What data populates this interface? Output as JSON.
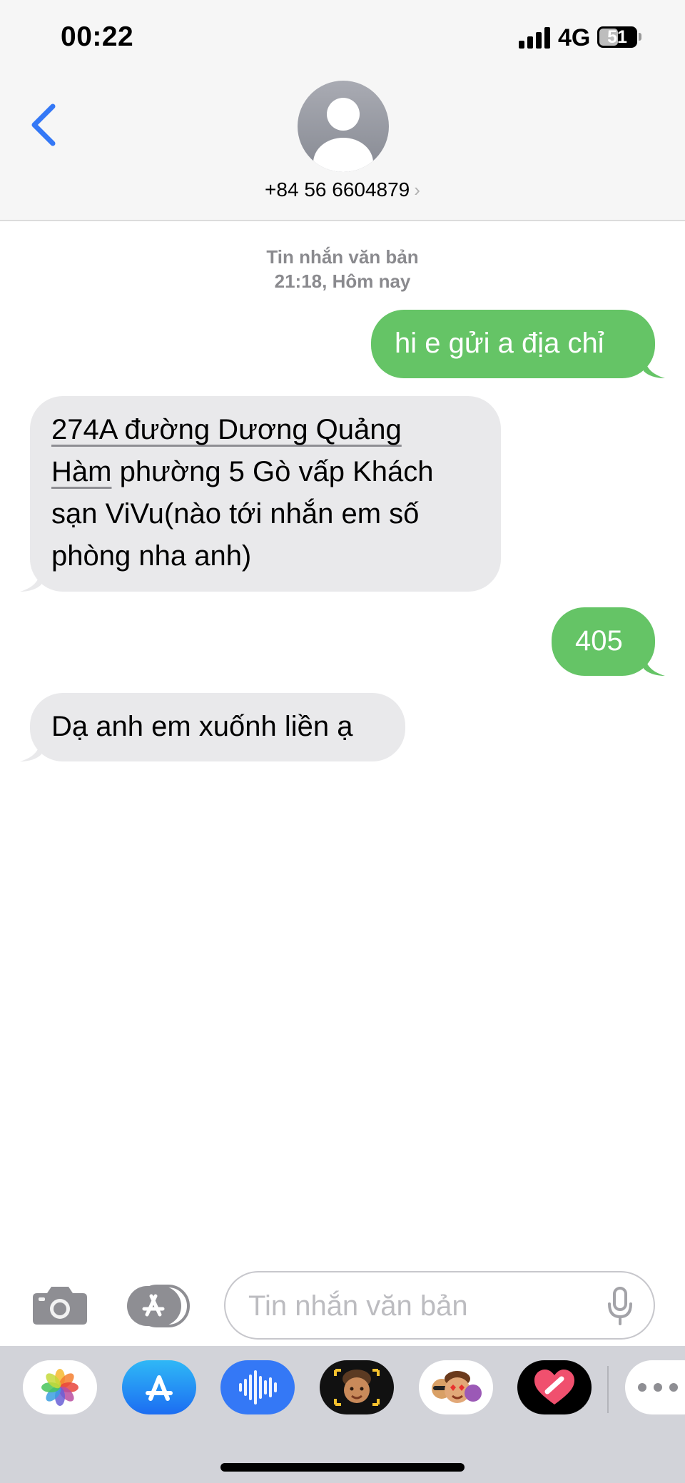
{
  "status_bar": {
    "time": "00:22",
    "network": "4G",
    "battery": "51",
    "battery_level": 0.51
  },
  "header": {
    "contact": "+84 56 6604879",
    "chevron": "›"
  },
  "conversation": {
    "meta_type": "Tin nhắn văn bản",
    "meta_time": "21:18, Hôm nay",
    "messages": [
      {
        "direction": "outgoing",
        "text": "hi e gửi a địa chỉ"
      },
      {
        "direction": "incoming",
        "lines": [
          "274A đường Dương Quảng",
          "Hàm phường 5 Gò vấp Khách",
          "sạn ViVu(nào tới nhắn em số",
          "phòng nha anh)"
        ],
        "link_part_1": "274A đường Dương Quảng",
        "link_part_2": "Hàm"
      },
      {
        "direction": "outgoing",
        "text": "405"
      },
      {
        "direction": "incoming",
        "text": "Dạ anh em xuốnh liền ạ"
      }
    ]
  },
  "input_bar": {
    "placeholder": "Tin nhắn văn bản",
    "value": ""
  },
  "drawer": {
    "apps": [
      "photos-icon",
      "app-store-icon",
      "audio-message-icon",
      "memoji-icon",
      "memoji-stickers-icon",
      "digital-touch-icon",
      "more-icon"
    ]
  },
  "colors": {
    "outgoing_bubble": "#65c466",
    "incoming_bubble": "#e9e9eb",
    "accent": "#3478f6"
  }
}
